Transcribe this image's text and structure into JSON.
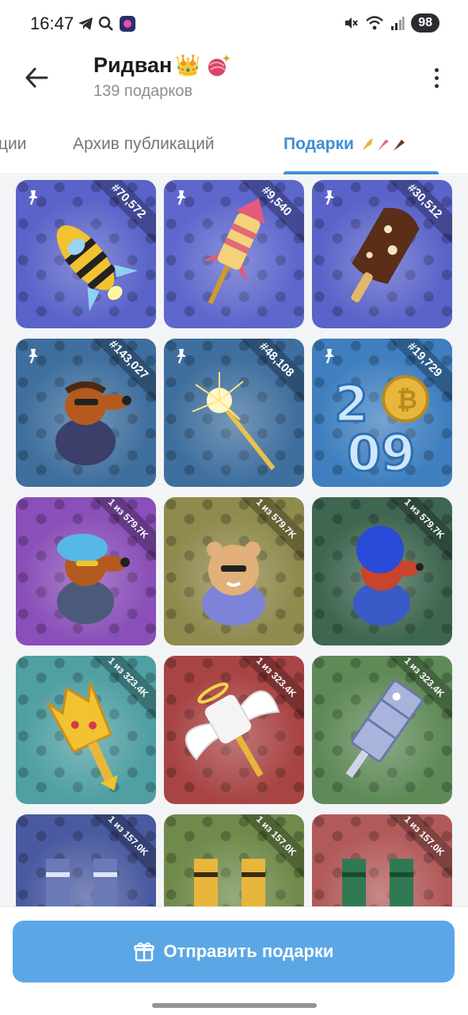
{
  "status": {
    "time": "16:47",
    "battery": "98"
  },
  "header": {
    "title": "Ридван",
    "subtitle": "139 подарков",
    "title_emoji": "👑"
  },
  "tabs": {
    "partial": "ции",
    "archive": "Архив публикаций",
    "gifts": "Подарки"
  },
  "cards": [
    {
      "label": "#70,572",
      "pinned": true,
      "bg": "#5a63c9",
      "kind": "rocket"
    },
    {
      "label": "#9,540",
      "pinned": true,
      "bg": "#5d67cc",
      "kind": "firework"
    },
    {
      "label": "#30,512",
      "pinned": true,
      "bg": "#5a63c9",
      "kind": "icecream"
    },
    {
      "label": "#143,027",
      "pinned": true,
      "bg": "#3f6f9e",
      "kind": "dog"
    },
    {
      "label": "#48,108",
      "pinned": true,
      "bg": "#3f6f9e",
      "kind": "sparkler"
    },
    {
      "label": "#19,729",
      "pinned": true,
      "bg": "#3f7fbf",
      "kind": "coin"
    },
    {
      "label": "1 из 579.7K",
      "pinned": false,
      "bg": "#8a4fb8",
      "kind": "dog2"
    },
    {
      "label": "1 из 579.7K",
      "pinned": false,
      "bg": "#8f8a4d",
      "kind": "bear"
    },
    {
      "label": "1 из 579.7K",
      "pinned": false,
      "bg": "#3f6651",
      "kind": "dog3"
    },
    {
      "label": "1 из 323.4K",
      "pinned": false,
      "bg": "#4f9fa3",
      "kind": "crown"
    },
    {
      "label": "1 из 323.4K",
      "pinned": false,
      "bg": "#a84444",
      "kind": "wings"
    },
    {
      "label": "1 из 323.4K",
      "pinned": false,
      "bg": "#5f8a58",
      "kind": "crystal"
    },
    {
      "label": "1 из 157.0K",
      "pinned": false,
      "bg": "#4a5aa0",
      "kind": "socks"
    },
    {
      "label": "1 из 157.0K",
      "pinned": false,
      "bg": "#6f8a4a",
      "kind": "socks2"
    },
    {
      "label": "1 из 157.0K",
      "pinned": false,
      "bg": "#b25a5a",
      "kind": "socks3"
    }
  ],
  "footer": {
    "send_label": "Отправить подарки"
  },
  "colors": {
    "accent": "#3e8fd6",
    "button": "#5ba7e6"
  }
}
